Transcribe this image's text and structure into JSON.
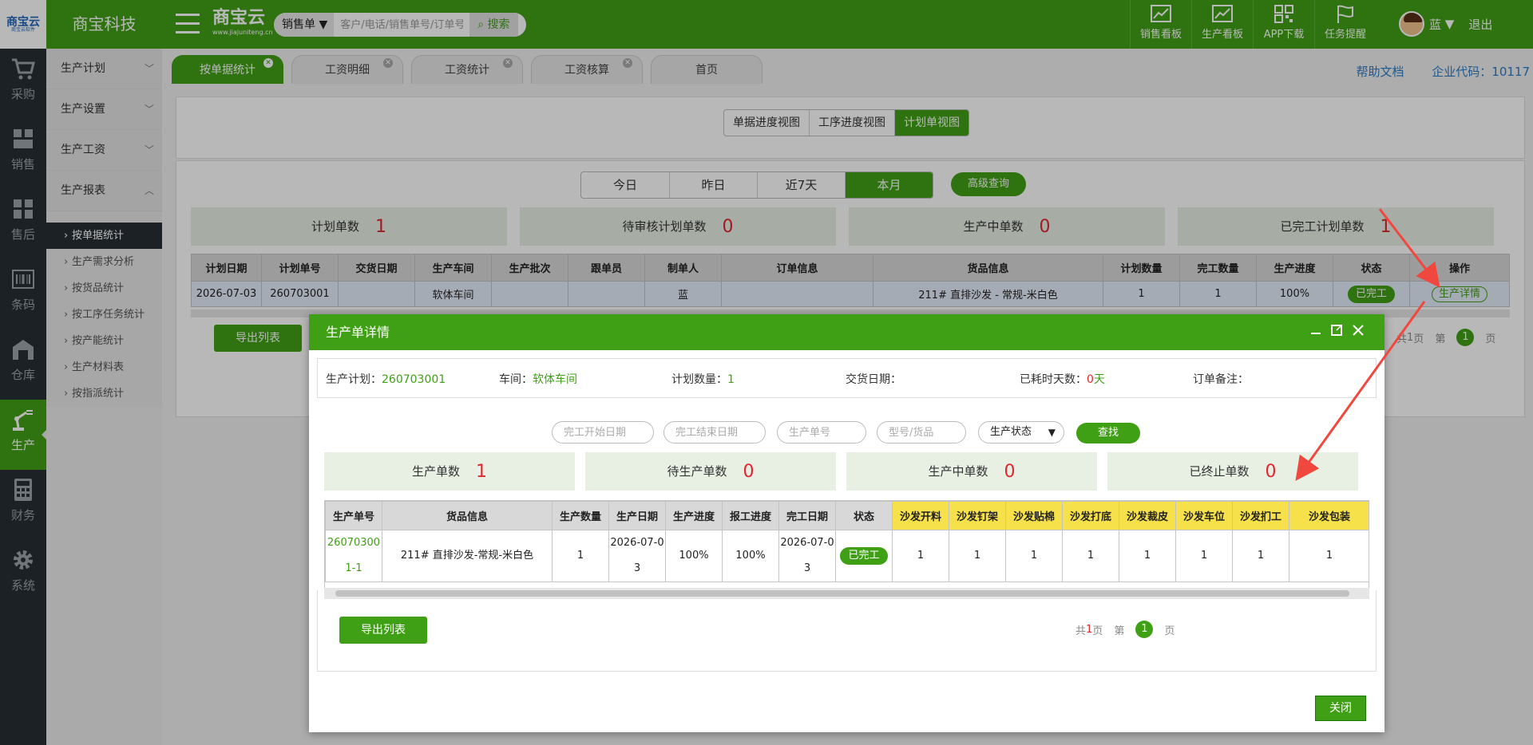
{
  "topbar": {
    "logo_text": "商宝云",
    "logo_sub": "商宝云软件",
    "company": "商宝科技",
    "brand": "商宝云",
    "brand_sub": "www.jiajuniteng.cn",
    "search_type": "销售单",
    "search_placeholder": "客户/电话/销售单号/订单号",
    "search_button": "搜索",
    "icons": [
      {
        "label": "销售看板",
        "icon": "chart-icon"
      },
      {
        "label": "生产看板",
        "icon": "chart-icon"
      },
      {
        "label": "APP下载",
        "icon": "qrcode-icon"
      },
      {
        "label": "任务提醒",
        "icon": "flag-icon"
      }
    ],
    "user_name": "蓝",
    "logout": "退出"
  },
  "leftnav": [
    {
      "label": "采购",
      "icon": "cart-icon"
    },
    {
      "label": "销售",
      "icon": "sales-icon"
    },
    {
      "label": "售后",
      "icon": "aftersale-icon"
    },
    {
      "label": "条码",
      "icon": "barcode-icon"
    },
    {
      "label": "仓库",
      "icon": "warehouse-icon"
    },
    {
      "label": "生产",
      "icon": "robot-arm-icon",
      "active": true
    },
    {
      "label": "财务",
      "icon": "calculator-icon"
    },
    {
      "label": "系统",
      "icon": "gear-icon"
    }
  ],
  "submenu": {
    "groups": [
      {
        "label": "生产计划"
      },
      {
        "label": "生产设置"
      },
      {
        "label": "生产工资"
      },
      {
        "label": "生产报表"
      }
    ],
    "items": [
      "按单据统计",
      "生产需求分析",
      "按货品统计",
      "按工序任务统计",
      "按产能统计",
      "生产材料表",
      "按指派统计"
    ]
  },
  "tabs": [
    "按单据统计",
    "工资明细",
    "工资统计",
    "工资核算",
    "首页"
  ],
  "toplinks": {
    "help": "帮助文档",
    "corp_label": "企业代码：10117"
  },
  "views": [
    "单据进度视图",
    "工序进度视图",
    "计划单视图"
  ],
  "dates": [
    "今日",
    "昨日",
    "近7天",
    "本月"
  ],
  "advanced": "高级查询",
  "stats": [
    {
      "label": "计划单数",
      "value": "1"
    },
    {
      "label": "待审核计划单数",
      "value": "0"
    },
    {
      "label": "生产中单数",
      "value": "0"
    },
    {
      "label": "已完工计划单数",
      "value": "1"
    }
  ],
  "table1": {
    "headers": [
      "计划日期",
      "计划单号",
      "交货日期",
      "生产车间",
      "生产批次",
      "跟单员",
      "制单人",
      "订单信息",
      "货品信息",
      "计划数量",
      "完工数量",
      "生产进度",
      "状态",
      "操作"
    ],
    "row": {
      "date": "2026-07-03",
      "no": "260703001",
      "delivery": "",
      "workshop": "软体车间",
      "batch": "",
      "follower": "",
      "creator": "蓝",
      "order": "",
      "goods": "211# 直排沙发 - 常规-米白色",
      "plan_qty": "1",
      "done_qty": "1",
      "progress": "100%",
      "status": "已完工",
      "action": "生产详情"
    }
  },
  "export": "导出列表",
  "pager": {
    "total_prefix": "共",
    "total_num": "1",
    "total_suffix": "页",
    "page_prefix": "第",
    "current": "1",
    "page_suffix": "页"
  },
  "modal": {
    "title": "生产单详情",
    "info": {
      "plan_label": "生产计划：",
      "plan_value": "260703001",
      "workshop_label": "车间：",
      "workshop_value": "软体车间",
      "qty_label": "计划数量：",
      "qty_value": "1",
      "delivery_label": "交货日期：",
      "delivery_value": "",
      "days_label": "已耗时天数：",
      "days_value": "0",
      "days_unit": "天",
      "remark_label": "订单备注：",
      "remark_value": ""
    },
    "filters": {
      "start_ph": "完工开始日期",
      "end_ph": "完工结束日期",
      "no_ph": "生产单号",
      "goods_ph": "型号/货品",
      "status": "生产状态",
      "search": "查找"
    },
    "stats": [
      {
        "label": "生产单数",
        "value": "1"
      },
      {
        "label": "待生产单数",
        "value": "0"
      },
      {
        "label": "生产中单数",
        "value": "0"
      },
      {
        "label": "已终止单数",
        "value": "0"
      }
    ],
    "table": {
      "headers": [
        "生产单号",
        "货品信息",
        "生产数量",
        "生产日期",
        "生产进度",
        "报工进度",
        "完工日期",
        "状态"
      ],
      "process_headers": [
        "沙发开料",
        "沙发钉架",
        "沙发贴棉",
        "沙发打底",
        "沙发裁皮",
        "沙发车位",
        "沙发扪工",
        "沙发包装"
      ],
      "row": {
        "no": "260703001-1",
        "goods": "211# 直排沙发-常规-米白色",
        "qty": "1",
        "date": "2026-07-03",
        "progress": "100%",
        "report": "100%",
        "done_date": "2026-07-03",
        "status": "已完工",
        "process": [
          "1",
          "1",
          "1",
          "1",
          "1",
          "1",
          "1",
          "1"
        ]
      }
    },
    "export": "导出列表",
    "close": "关闭"
  },
  "colors": {
    "primary": "#40a015",
    "red": "#e0262f",
    "dark": "#272e35",
    "yellow": "#f7e14a",
    "arrow": "#f0473e"
  }
}
